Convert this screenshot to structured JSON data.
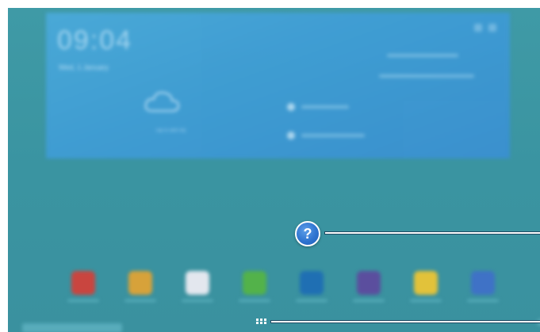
{
  "widget": {
    "clock": "09:04",
    "date": "Wed, 1 January",
    "weather_caption": "Tap to add city"
  },
  "help": {
    "icon_glyph": "?",
    "icon": "help-icon"
  },
  "apps": [
    {
      "name": "email-app-icon",
      "color": "#c9453f"
    },
    {
      "name": "chrome-app-icon",
      "color": "#d7a23a"
    },
    {
      "name": "calendar-app-icon",
      "color": "#e3e7ee"
    },
    {
      "name": "phone-app-icon",
      "color": "#53b24a"
    },
    {
      "name": "internet-app-icon",
      "color": "#1f6fb3"
    },
    {
      "name": "camera-app-icon",
      "color": "#5b4e9e"
    },
    {
      "name": "memo-app-icon",
      "color": "#e2c23a"
    },
    {
      "name": "settings-app-icon",
      "color": "#3f72c6"
    }
  ],
  "bottom_bar": {
    "apps_grid_icon": "apps-grid-icon"
  }
}
